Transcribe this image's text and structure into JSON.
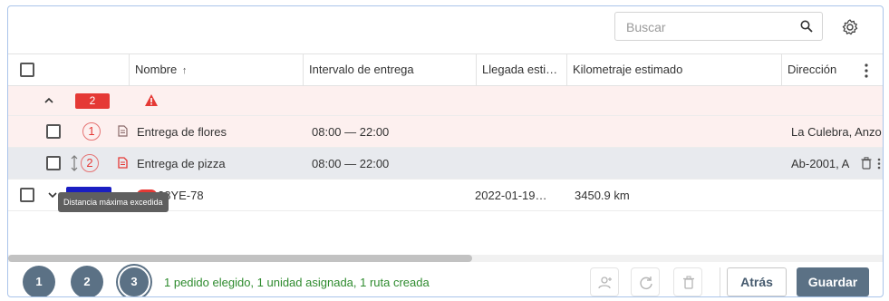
{
  "search": {
    "placeholder": "Buscar"
  },
  "table": {
    "columns": {
      "nombre": "Nombre",
      "sort_indicator": "↑",
      "intervalo": "Intervalo de entrega",
      "llegada": "Llegada esti…",
      "kilometraje": "Kilometraje estimado",
      "direccion": "Dirección"
    },
    "group": {
      "count": "2",
      "warning_icon": "warning-icon"
    },
    "rows": [
      {
        "index": "1",
        "nombre": "Entrega de flores",
        "intervalo": "08:00 — 22:00",
        "direccion": "La Culebra, Anzo"
      },
      {
        "index": "2",
        "nombre": "Entrega de pizza",
        "intervalo": "08:00 — 22:00",
        "direccion": "Ab-2001, A"
      }
    ],
    "route_row": {
      "vehicle": "…28YE-78",
      "llegada": "2022-01-19…",
      "kilometraje": "3450.9 km"
    },
    "tooltip": "Distancia máxima excedida"
  },
  "footer": {
    "steps": [
      "1",
      "2",
      "3"
    ],
    "active_step": "3",
    "status": "1 pedido elegido, 1 unidad asignada, 1 ruta creada",
    "back_label": "Atrás",
    "save_label": "Guardar"
  },
  "colors": {
    "accent": "#5b7185",
    "error": "#e53935",
    "success": "#2e8b2e",
    "route_badge": "#1a1ec2"
  }
}
